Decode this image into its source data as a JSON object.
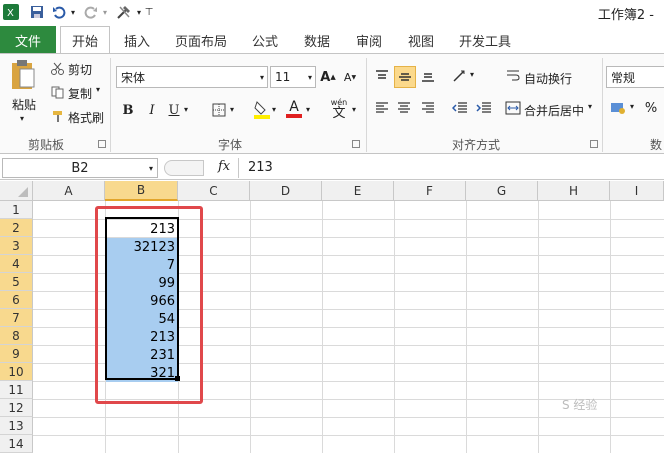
{
  "app": {
    "title": "工作簿2 -"
  },
  "tabs": [
    "文件",
    "开始",
    "插入",
    "页面布局",
    "公式",
    "数据",
    "审阅",
    "视图",
    "开发工具"
  ],
  "clipboard": {
    "paste": "粘贴",
    "cut": "剪切",
    "copy": "复制",
    "format_painter": "格式刷",
    "label": "剪贴板"
  },
  "font": {
    "name": "宋体",
    "size": "11",
    "bold": "B",
    "italic": "I",
    "underline": "U",
    "label": "字体",
    "grow": "A",
    "shrink": "A",
    "color": "A",
    "phonetic": "wén"
  },
  "alignment": {
    "wrap": "自动换行",
    "merge": "合并后居中",
    "label": "对齐方式"
  },
  "number": {
    "format": "常规",
    "percent": "%",
    "label": "数"
  },
  "formula_bar": {
    "name_box": "B2",
    "fx": "fx",
    "value": "213"
  },
  "columns": [
    "A",
    "B",
    "C",
    "D",
    "E",
    "F",
    "G",
    "H",
    "I"
  ],
  "rows": [
    "1",
    "2",
    "3",
    "4",
    "5",
    "6",
    "7",
    "8",
    "9",
    "10",
    "11",
    "12",
    "13",
    "14"
  ],
  "cells_b": [
    "",
    "213",
    "32123",
    "7",
    "99",
    "966",
    "54",
    "213",
    "231",
    "321",
    "",
    "",
    "",
    ""
  ],
  "watermark": "S 经验",
  "colors": {
    "file_tab": "#2d8a3e",
    "selection_fill": "#a8cdf0",
    "header_selected": "#f8d98e",
    "annotation": "#e0484b"
  }
}
